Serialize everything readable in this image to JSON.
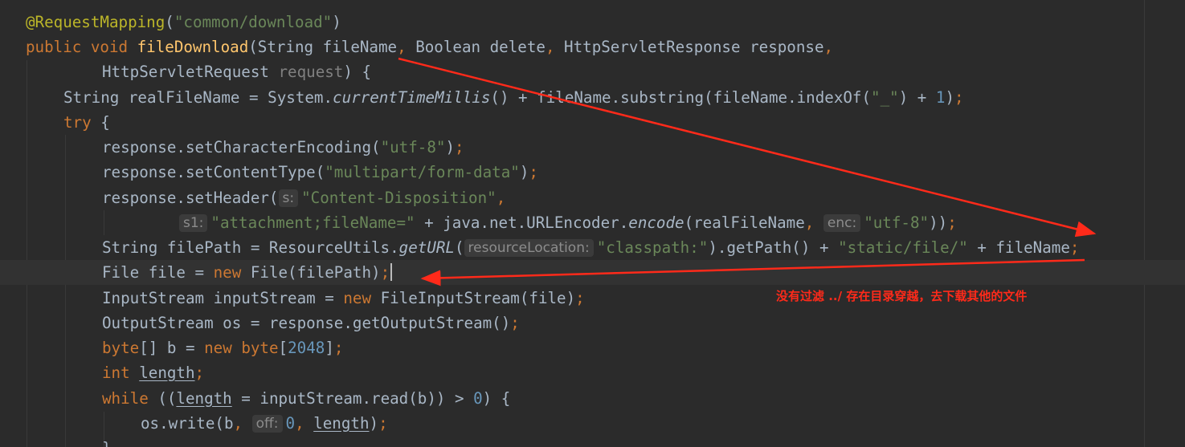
{
  "lines": {
    "l1": {
      "ann": "@RequestMapping",
      "p1": "(",
      "str": "\"common/download\"",
      "p2": ")"
    },
    "l2": {
      "mod": "public void ",
      "fn": "fileDownload",
      "a": "(String fileName",
      "c1": ",",
      "b": " Boolean delete",
      "c2": ",",
      "c": " HttpServletResponse response",
      "c3": ","
    },
    "l3": {
      "a": "HttpServletRequest ",
      "unused": "request",
      "b": ") {"
    },
    "l4": {
      "a": "String realFileName = System.",
      "m": "currentTimeMillis",
      "b": "() + fileName.substring(fileName.indexOf(",
      "s": "\"_\"",
      "c": ") + ",
      "n": "1",
      "d": ")",
      "semi": ";"
    },
    "l5": {
      "kw": "try",
      "b": " {"
    },
    "l6": {
      "a": "response.setCharacterEncoding(",
      "s": "\"utf-8\"",
      "b": ")",
      "semi": ";"
    },
    "l7": {
      "a": "response.setContentType(",
      "s": "\"multipart/form-data\"",
      "b": ")",
      "semi": ";"
    },
    "l8": {
      "a": "response.setHeader(",
      "hint": "s:",
      "s": "\"Content-Disposition\"",
      "c": ","
    },
    "l9": {
      "hint1": "s1:",
      "s1": "\"attachment;fileName=\"",
      "a": " + java.net.URLEncoder.",
      "m": "encode",
      "b": "(realFileName",
      "c": ",",
      "hint2": "enc:",
      "s2": "\"utf-8\"",
      "d": "))",
      "semi": ";"
    },
    "l10": {
      "a": "String filePath = ResourceUtils.",
      "m": "getURL",
      "b": "(",
      "hint": "resourceLocation:",
      "s1": "\"classpath:\"",
      "c": ").getPath() + ",
      "s2": "\"static/file/\"",
      "d": " + fileName",
      "semi": ";"
    },
    "l11": {
      "a": "File file = ",
      "kw": "new",
      "b": " File(filePath)",
      "semi": ";"
    },
    "l12": {
      "a": "InputStream inputStream = ",
      "kw": "new",
      "b": " FileInputStream(file)",
      "semi": ";"
    },
    "l13": {
      "a": "OutputStream os = response.getOutputStream()",
      "semi": ";"
    },
    "l14": {
      "kw1": "byte",
      "a": "[] b = ",
      "kw2": "new",
      "sp": " ",
      "kw3": "byte",
      "b": "[",
      "n": "2048",
      "c": "]",
      "semi": ";"
    },
    "l15": {
      "kw": "int",
      "sp": " ",
      "v": "length",
      "semi": ";"
    },
    "l16": {
      "kw": "while",
      "a": " ((",
      "v": "length",
      "b": " = inputStream.read(b)) > ",
      "n": "0",
      "c": ") {"
    },
    "l17": {
      "a": "os.write(b",
      "c1": ",",
      "hint": "off:",
      "n": "0",
      "c2": ",",
      "sp": " ",
      "v": "length",
      "b": ")",
      "semi": ";"
    },
    "l18": {
      "a": "}"
    }
  },
  "annotation": {
    "note": "没有过滤 ../ 存在目录穿越，去下载其他的文件",
    "color": "#ff2a1a"
  },
  "colors": {
    "background": "#2b2b2b",
    "caret_line": "#323232",
    "text": "#a9b7c6",
    "keyword": "#cc7832",
    "string": "#6a8759",
    "number": "#6897bb",
    "annotation": "#bbb529",
    "function": "#ffc66d"
  }
}
